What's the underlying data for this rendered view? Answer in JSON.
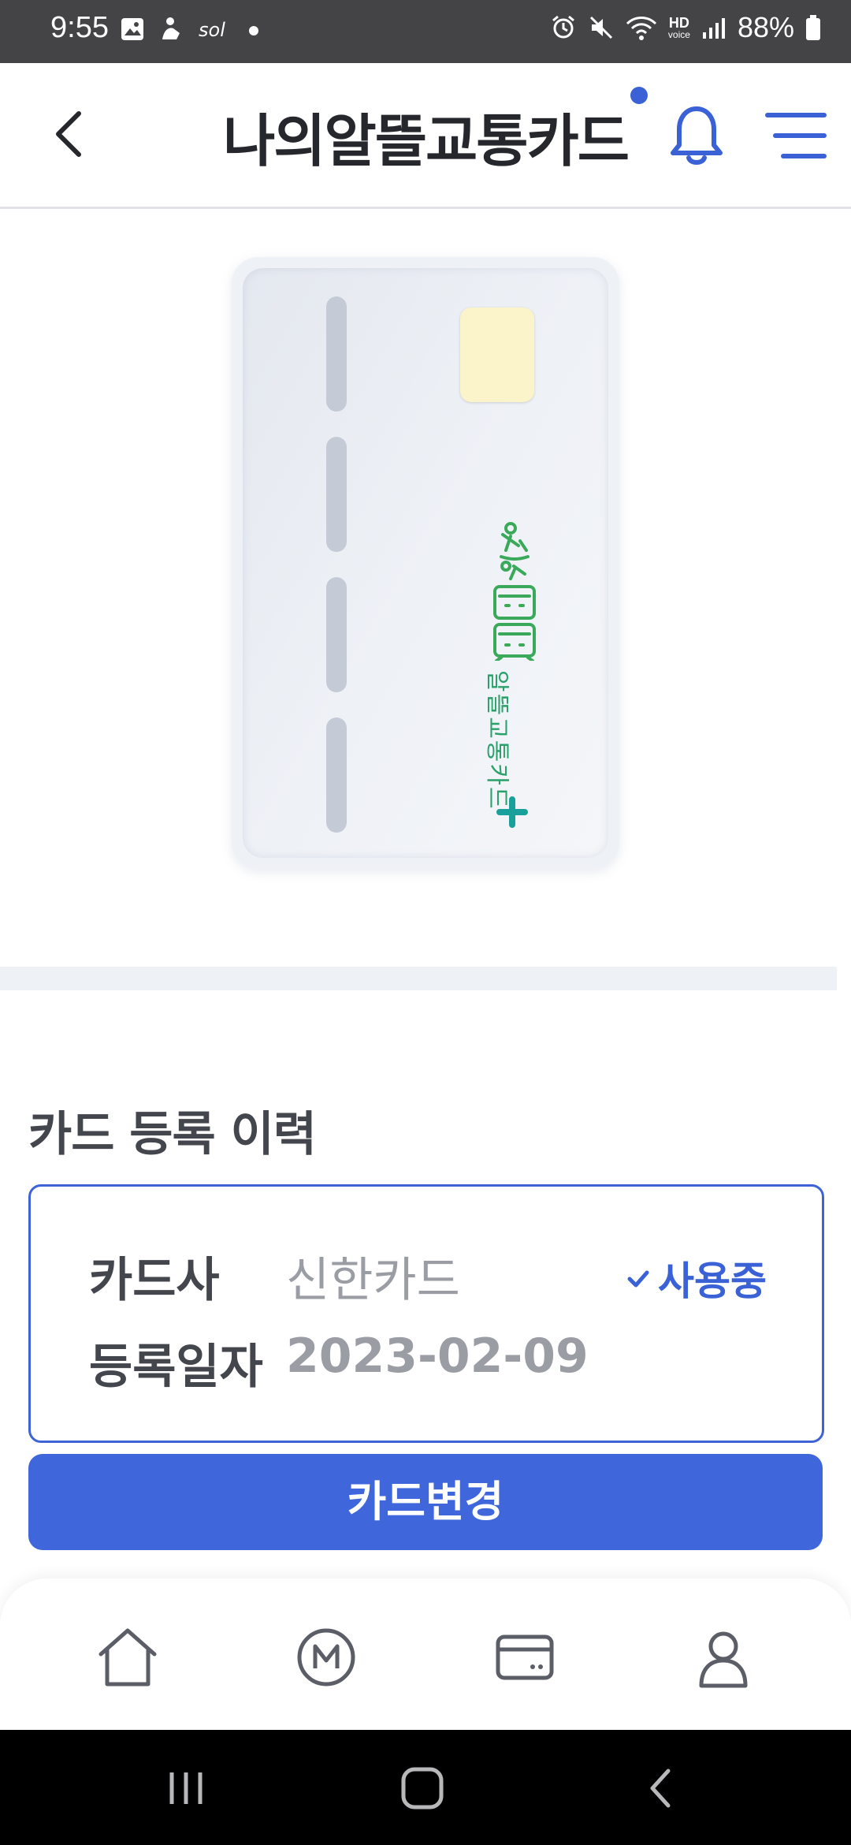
{
  "status_bar": {
    "time": "9:55",
    "battery": "88%",
    "hd_label": "HD",
    "voice_label": "voice",
    "icons": [
      "gallery-icon",
      "app-icon",
      "sol-icon",
      "dot-icon",
      "alarm-icon",
      "mute-icon",
      "wifi-icon",
      "signal-icon",
      "battery-icon"
    ]
  },
  "header": {
    "title": "나의알뜰교통카드",
    "back_icon": "back-icon",
    "notification_icon": "bell-icon",
    "menu_icon": "menu-icon",
    "accent_color": "#3a62d6"
  },
  "card": {
    "logo_text": "알뜰교통카드"
  },
  "history": {
    "section_title": "카드 등록 이력",
    "issuer_label": "카드사",
    "issuer_value": "신한카드",
    "date_label": "등록일자",
    "date_value": "2023-02-09",
    "status": "사용중"
  },
  "actions": {
    "change_card": "카드변경"
  },
  "bottom_nav": {
    "items": [
      "home-icon",
      "mileage-icon",
      "card-icon",
      "profile-icon"
    ]
  },
  "system_nav": {
    "items": [
      "recents-icon",
      "home-button-icon",
      "back-button-icon"
    ]
  }
}
